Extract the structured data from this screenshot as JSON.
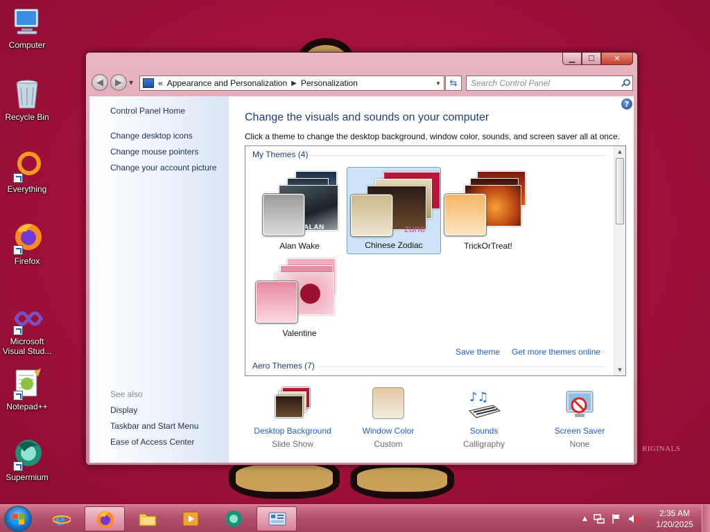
{
  "desktop": {
    "icons": [
      {
        "label": "Computer"
      },
      {
        "label": "Recycle Bin"
      },
      {
        "label": "Everything"
      },
      {
        "label": "Firefox"
      },
      {
        "label": "Microsoft Visual Stud..."
      },
      {
        "label": "Notepad++"
      },
      {
        "label": "Supermium"
      }
    ],
    "watermark": "RIGINALS"
  },
  "window": {
    "address": {
      "prefix": "«",
      "crumbs": [
        "Appearance and Personalization",
        "Personalization"
      ]
    },
    "search_placeholder": "Search Control Panel",
    "left_pane": {
      "home": "Control Panel Home",
      "links": [
        "Change desktop icons",
        "Change mouse pointers",
        "Change your account picture"
      ],
      "see_also_heading": "See also",
      "see_also": [
        "Display",
        "Taskbar and Start Menu",
        "Ease of Access Center"
      ]
    },
    "title": "Change the visuals and sounds on your computer",
    "description": "Click a theme to change the desktop background, window color, sounds, and screen saver all at once.",
    "themes": {
      "my_themes_heading": "My Themes (4)",
      "items": [
        {
          "name": "Alan Wake",
          "badge": "ALAN WAKE",
          "selected": false
        },
        {
          "name": "Chinese Zodiac",
          "badge": "zune",
          "selected": true
        },
        {
          "name": "TrickOrTreat!",
          "badge": "",
          "selected": false
        },
        {
          "name": "Valentine",
          "badge": "",
          "selected": false
        }
      ],
      "save_theme": "Save theme",
      "get_more": "Get more themes online",
      "aero_heading": "Aero Themes (7)"
    },
    "bottom": [
      {
        "link": "Desktop Background",
        "sub": "Slide Show"
      },
      {
        "link": "Window Color",
        "sub": "Custom"
      },
      {
        "link": "Sounds",
        "sub": "Calligraphy"
      },
      {
        "link": "Screen Saver",
        "sub": "None"
      }
    ]
  },
  "taskbar": {
    "clock_time": "2:35 AM",
    "clock_date": "1/20/2025",
    "tray_chevron": "▲"
  },
  "colors": {
    "link": "#1f5fc7",
    "heading": "#1e3d7a",
    "desktop": "#a3123a",
    "taskbar": "#b5506c"
  }
}
